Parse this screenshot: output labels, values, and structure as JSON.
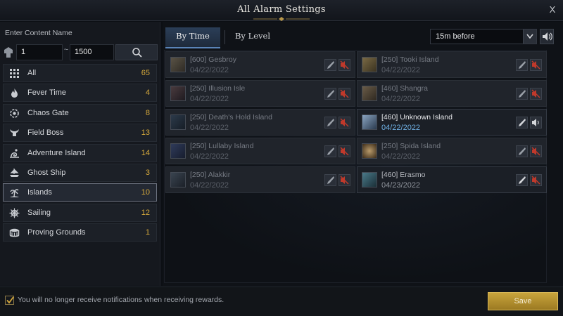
{
  "window": {
    "title": "All Alarm Settings",
    "close_label": "X"
  },
  "sidebar": {
    "search_label": "Enter Content Name",
    "level_min": "1",
    "level_sep": "~",
    "level_max": "1500",
    "categories": [
      {
        "label": "All",
        "count": "65",
        "icon": "grid-icon"
      },
      {
        "label": "Fever Time",
        "count": "4",
        "icon": "flame-icon"
      },
      {
        "label": "Chaos Gate",
        "count": "8",
        "icon": "gate-icon"
      },
      {
        "label": "Field Boss",
        "count": "13",
        "icon": "horned-skull-icon"
      },
      {
        "label": "Adventure Island",
        "count": "14",
        "icon": "island-swirl-icon"
      },
      {
        "label": "Ghost Ship",
        "count": "3",
        "icon": "ship-icon"
      },
      {
        "label": "Islands",
        "count": "10",
        "icon": "palm-island-icon",
        "selected": true
      },
      {
        "label": "Sailing",
        "count": "12",
        "icon": "ship-wheel-icon"
      },
      {
        "label": "Proving Grounds",
        "count": "1",
        "icon": "arena-icon"
      }
    ]
  },
  "main": {
    "tabs": [
      {
        "label": "By Time",
        "active": true
      },
      {
        "label": "By Level",
        "active": false
      }
    ],
    "time_select": "15m before",
    "alarms_left": [
      {
        "name": "[600] Gesbroy",
        "date": "04/22/2022",
        "active": false
      },
      {
        "name": "[250] Illusion Isle",
        "date": "04/22/2022",
        "active": false
      },
      {
        "name": "[250] Death's Hold Island",
        "date": "04/22/2022",
        "active": false
      },
      {
        "name": "[250] Lullaby Island",
        "date": "04/22/2022",
        "active": false
      },
      {
        "name": "[250] Alakkir",
        "date": "04/22/2022",
        "active": false
      }
    ],
    "alarms_right": [
      {
        "name": "[250] Tooki Island",
        "date": "04/22/2022",
        "active": false
      },
      {
        "name": "[460] Shangra",
        "date": "04/22/2022",
        "active": false
      },
      {
        "name": "[460] Unknown Island",
        "date": "04/22/2022",
        "active": true
      },
      {
        "name": "[250] Spida Island",
        "date": "04/22/2022",
        "active": false
      },
      {
        "name": "[460] Erasmo",
        "date": "04/23/2022",
        "active": true
      }
    ]
  },
  "footer": {
    "notice": "You will no longer receive notifications when receiving rewards.",
    "checked": true,
    "save_label": "Save"
  },
  "colors": {
    "accent_gold": "#d6a93c",
    "active_date_blue": "#6fb0e4",
    "mute_red": "#c0392b",
    "save_gold": "#c9a43c"
  }
}
